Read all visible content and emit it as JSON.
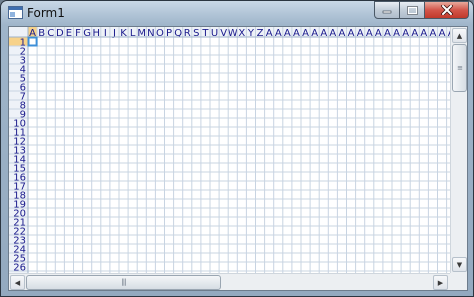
{
  "window": {
    "title": "Form1"
  },
  "sheet": {
    "column_headers": [
      "A",
      "B",
      "C",
      "D",
      "E",
      "F",
      "G",
      "H",
      "I",
      "J",
      "K",
      "L",
      "M",
      "N",
      "O",
      "P",
      "Q",
      "R",
      "S",
      "T",
      "U",
      "V",
      "W",
      "X",
      "Y",
      "Z",
      "A",
      "A",
      "A",
      "A",
      "A",
      "A",
      "A",
      "A",
      "A",
      "A",
      "A",
      "A",
      "A",
      "A",
      "A",
      "A",
      "A",
      "A",
      "A",
      "A",
      "A",
      "A"
    ],
    "row_headers": [
      "1",
      "2",
      "3",
      "4",
      "5",
      "6",
      "7",
      "8",
      "9",
      "10",
      "11",
      "12",
      "13",
      "14",
      "15",
      "16",
      "17",
      "18",
      "19",
      "20",
      "21",
      "22",
      "23",
      "24",
      "25",
      "26"
    ],
    "selected_cell": {
      "column": "A",
      "row": "1"
    },
    "colors": {
      "header_text": "#1a1a8c",
      "selected_header": "#f7d28a",
      "selected_border": "#3d8fd8",
      "grid_line": "#c8d4e2",
      "header_bg": "#eef2f8"
    }
  },
  "scrollbars": {
    "vertical": {
      "up_arrow": "▲",
      "down_arrow": "▼",
      "thumb_grip": "≡",
      "position": 0
    },
    "horizontal": {
      "left_arrow": "◀",
      "right_arrow": "▶",
      "thumb_grip": "|||",
      "position": 0
    }
  },
  "icons": {
    "app": "window-app-icon",
    "minimize": "minimize-icon",
    "maximize": "maximize-icon",
    "close": "close-icon"
  }
}
